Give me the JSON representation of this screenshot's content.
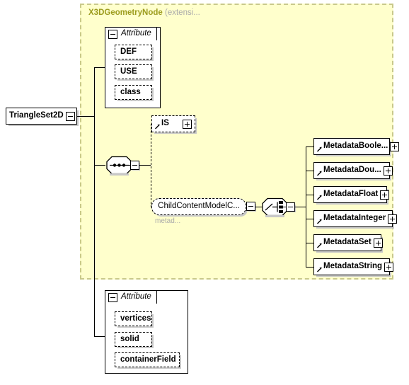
{
  "diagram": {
    "type": "xsd-schema-diagram",
    "root_element": {
      "label": "TriangleSet2D",
      "expander": "minus"
    },
    "extension_group": {
      "title": "X3DGeometryNode",
      "subtitle": "(extensi...",
      "background_color": "#FFFFCC",
      "border_color": "#C9C98A",
      "title_color": "#9C9C1E"
    },
    "inherited_attributes": {
      "header_label": "Attribute",
      "expander": "minus",
      "items": [
        {
          "label": "DEF"
        },
        {
          "label": "USE"
        },
        {
          "label": "class"
        }
      ]
    },
    "content_model": {
      "compositor": "sequence",
      "expander": "minus",
      "children": [
        {
          "kind": "element-ref",
          "label": "IS",
          "expander": "plus",
          "optional": true,
          "has_type_ref_arrow": true
        },
        {
          "kind": "group-ref",
          "label": "ChildContentModelC...",
          "sublabel": "metad...",
          "expander": "minus"
        }
      ]
    },
    "child_choice": {
      "compositor": "choice",
      "expander": "minus",
      "elements": [
        {
          "label": "MetadataBoole...",
          "expander": "plus",
          "has_type_ref_arrow": true
        },
        {
          "label": "MetadataDou...",
          "expander": "plus",
          "has_type_ref_arrow": true
        },
        {
          "label": "MetadataFloat",
          "expander": "plus",
          "has_type_ref_arrow": true
        },
        {
          "label": "MetadataInteger",
          "expander": "plus",
          "has_type_ref_arrow": true
        },
        {
          "label": "MetadataSet",
          "expander": "plus",
          "has_type_ref_arrow": true
        },
        {
          "label": "MetadataString",
          "expander": "plus",
          "has_type_ref_arrow": true
        }
      ]
    },
    "own_attributes": {
      "header_label": "Attribute",
      "expander": "minus",
      "items": [
        {
          "label": "vertices"
        },
        {
          "label": "solid"
        },
        {
          "label": "containerField"
        }
      ]
    }
  }
}
